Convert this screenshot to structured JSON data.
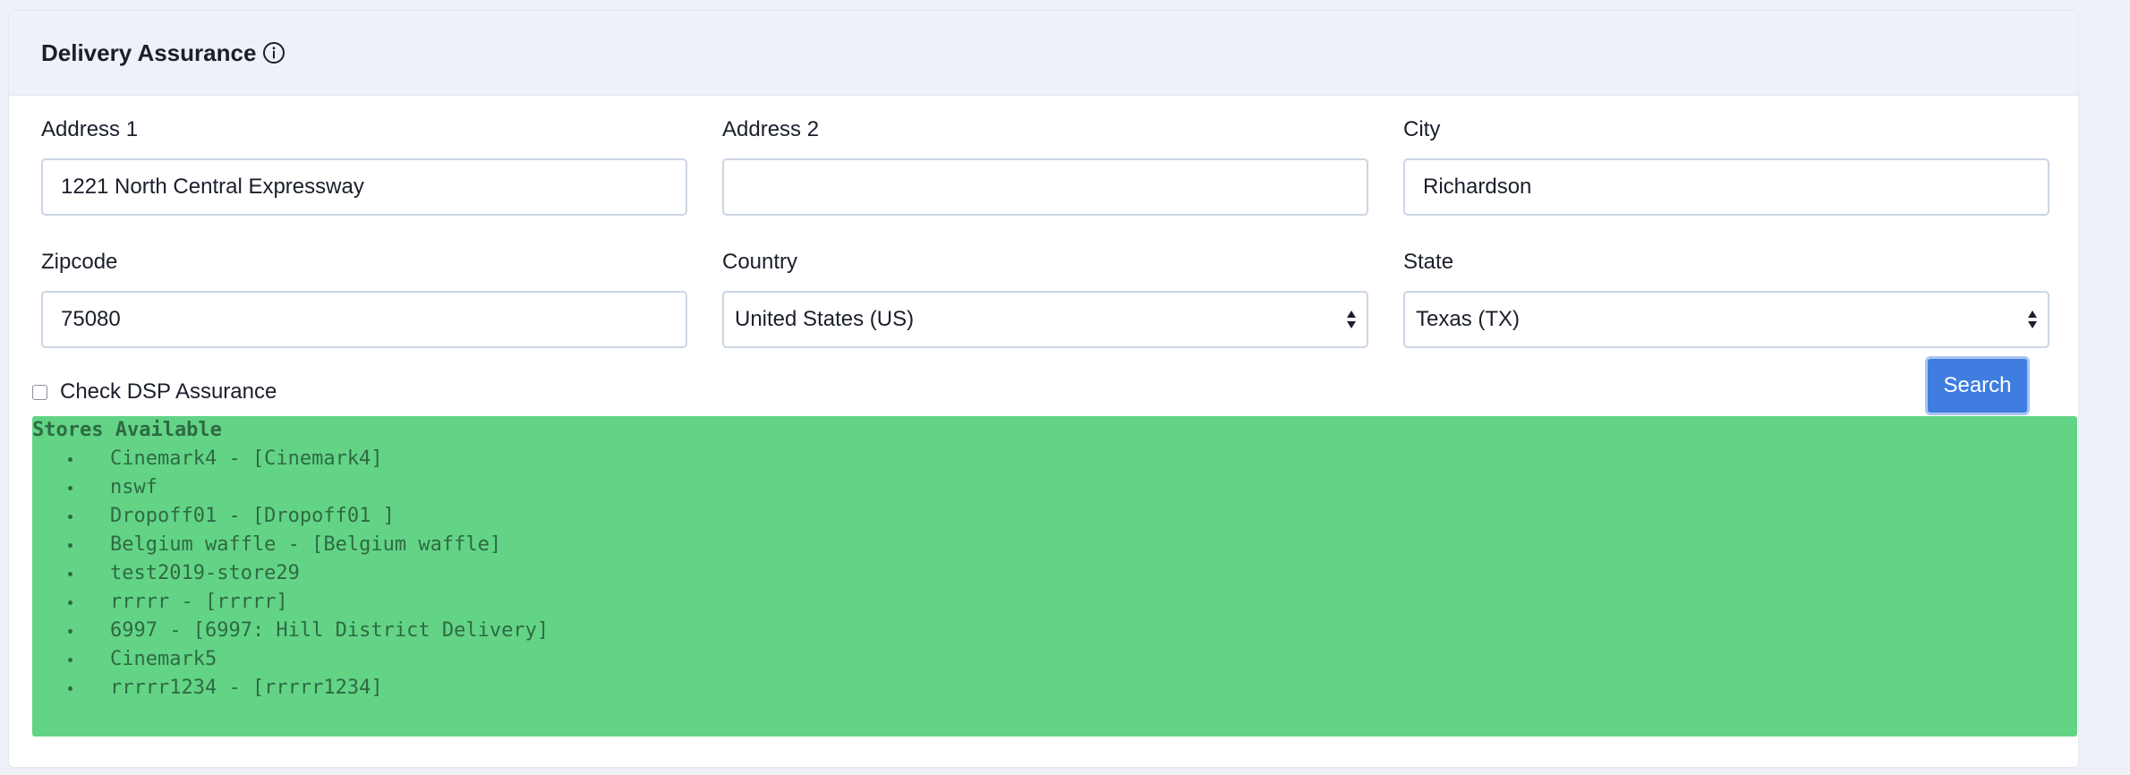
{
  "header": {
    "title": "Delivery Assurance",
    "info_icon": "info-circle-icon"
  },
  "form": {
    "address1": {
      "label": "Address 1",
      "value": "1221 North Central Expressway",
      "placeholder": ""
    },
    "address2": {
      "label": "Address 2",
      "value": "",
      "placeholder": ""
    },
    "city": {
      "label": "City",
      "value": "Richardson",
      "placeholder": ""
    },
    "zipcode": {
      "label": "Zipcode",
      "value": "75080",
      "placeholder": ""
    },
    "country": {
      "label": "Country",
      "selected": "United States (US)"
    },
    "state": {
      "label": "State",
      "selected": "Texas (TX)"
    },
    "dsp_check": {
      "label": "Check DSP Assurance",
      "checked": false
    },
    "search_label": "Search"
  },
  "stores": {
    "heading": "Stores Available",
    "items": [
      "Cinemark4 - [Cinemark4]",
      "nswf",
      "Dropoff01 - [Dropoff01 ]",
      "Belgium waffle - [Belgium waffle]",
      "test2019-store29",
      "rrrrr - [rrrrr]",
      "6997 - [6997: Hill District Delivery]",
      "Cinemark5",
      "rrrrr1234 - [rrrrr1234]"
    ]
  },
  "colors": {
    "accent": "#3f7de0",
    "success_bg": "#63d486",
    "header_bg": "#edf2f9"
  }
}
